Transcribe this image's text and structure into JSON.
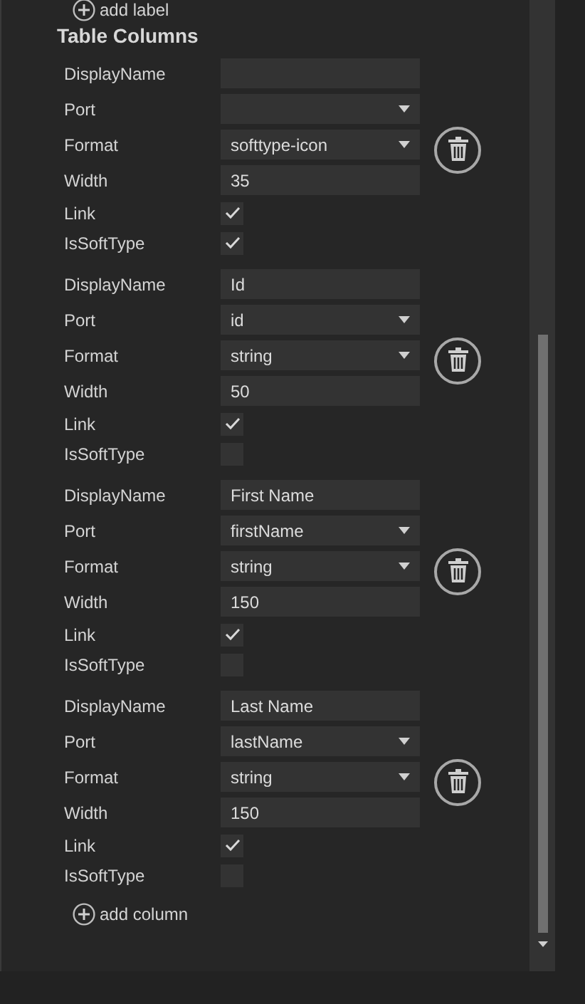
{
  "add_label": {
    "text": "add label"
  },
  "section_title": "Table Columns",
  "columns": [
    {
      "fields": [
        {
          "kind": "text",
          "label": "DisplayName"
        },
        {
          "kind": "select",
          "label": "Port"
        },
        {
          "kind": "select",
          "label": "Format",
          "value": "softtype-icon"
        },
        {
          "kind": "text",
          "label": "Width",
          "value": "35"
        },
        {
          "kind": "check",
          "label": "Link",
          "checked": true
        },
        {
          "kind": "check",
          "label": "IsSoftType",
          "checked": true
        }
      ]
    },
    {
      "fields": [
        {
          "kind": "text",
          "label": "DisplayName",
          "value": "Id"
        },
        {
          "kind": "select",
          "label": "Port",
          "value": "id"
        },
        {
          "kind": "select",
          "label": "Format",
          "value": "string"
        },
        {
          "kind": "text",
          "label": "Width",
          "value": "50"
        },
        {
          "kind": "check",
          "label": "Link",
          "checked": true
        },
        {
          "kind": "check",
          "label": "IsSoftType",
          "checked": false
        }
      ]
    },
    {
      "fields": [
        {
          "kind": "text",
          "label": "DisplayName",
          "value": "First Name"
        },
        {
          "kind": "select",
          "label": "Port",
          "value": "firstName"
        },
        {
          "kind": "select",
          "label": "Format",
          "value": "string"
        },
        {
          "kind": "text",
          "label": "Width",
          "value": "150"
        },
        {
          "kind": "check",
          "label": "Link",
          "checked": true
        },
        {
          "kind": "check",
          "label": "IsSoftType",
          "checked": false
        }
      ]
    },
    {
      "fields": [
        {
          "kind": "text",
          "label": "DisplayName",
          "value": "Last Name"
        },
        {
          "kind": "select",
          "label": "Port",
          "value": "lastName"
        },
        {
          "kind": "select",
          "label": "Format",
          "value": "string"
        },
        {
          "kind": "text",
          "label": "Width",
          "value": "150"
        },
        {
          "kind": "check",
          "label": "Link",
          "checked": true
        },
        {
          "kind": "check",
          "label": "IsSoftType",
          "checked": false
        }
      ]
    }
  ],
  "add_column": {
    "text": "add column"
  }
}
